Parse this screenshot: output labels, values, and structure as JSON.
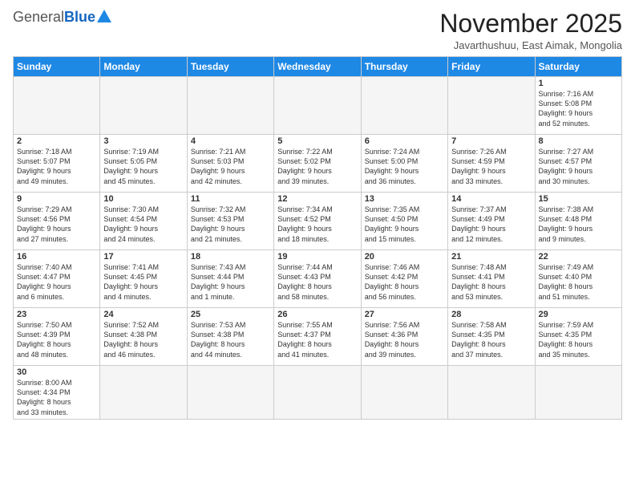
{
  "logo": {
    "general": "General",
    "blue": "Blue"
  },
  "header": {
    "month": "November 2025",
    "location": "Javarthushuu, East Aimak, Mongolia"
  },
  "weekdays": [
    "Sunday",
    "Monday",
    "Tuesday",
    "Wednesday",
    "Thursday",
    "Friday",
    "Saturday"
  ],
  "weeks": [
    [
      {
        "day": "",
        "info": ""
      },
      {
        "day": "",
        "info": ""
      },
      {
        "day": "",
        "info": ""
      },
      {
        "day": "",
        "info": ""
      },
      {
        "day": "",
        "info": ""
      },
      {
        "day": "",
        "info": ""
      },
      {
        "day": "1",
        "info": "Sunrise: 7:16 AM\nSunset: 5:08 PM\nDaylight: 9 hours\nand 52 minutes."
      }
    ],
    [
      {
        "day": "2",
        "info": "Sunrise: 7:18 AM\nSunset: 5:07 PM\nDaylight: 9 hours\nand 49 minutes."
      },
      {
        "day": "3",
        "info": "Sunrise: 7:19 AM\nSunset: 5:05 PM\nDaylight: 9 hours\nand 45 minutes."
      },
      {
        "day": "4",
        "info": "Sunrise: 7:21 AM\nSunset: 5:03 PM\nDaylight: 9 hours\nand 42 minutes."
      },
      {
        "day": "5",
        "info": "Sunrise: 7:22 AM\nSunset: 5:02 PM\nDaylight: 9 hours\nand 39 minutes."
      },
      {
        "day": "6",
        "info": "Sunrise: 7:24 AM\nSunset: 5:00 PM\nDaylight: 9 hours\nand 36 minutes."
      },
      {
        "day": "7",
        "info": "Sunrise: 7:26 AM\nSunset: 4:59 PM\nDaylight: 9 hours\nand 33 minutes."
      },
      {
        "day": "8",
        "info": "Sunrise: 7:27 AM\nSunset: 4:57 PM\nDaylight: 9 hours\nand 30 minutes."
      }
    ],
    [
      {
        "day": "9",
        "info": "Sunrise: 7:29 AM\nSunset: 4:56 PM\nDaylight: 9 hours\nand 27 minutes."
      },
      {
        "day": "10",
        "info": "Sunrise: 7:30 AM\nSunset: 4:54 PM\nDaylight: 9 hours\nand 24 minutes."
      },
      {
        "day": "11",
        "info": "Sunrise: 7:32 AM\nSunset: 4:53 PM\nDaylight: 9 hours\nand 21 minutes."
      },
      {
        "day": "12",
        "info": "Sunrise: 7:34 AM\nSunset: 4:52 PM\nDaylight: 9 hours\nand 18 minutes."
      },
      {
        "day": "13",
        "info": "Sunrise: 7:35 AM\nSunset: 4:50 PM\nDaylight: 9 hours\nand 15 minutes."
      },
      {
        "day": "14",
        "info": "Sunrise: 7:37 AM\nSunset: 4:49 PM\nDaylight: 9 hours\nand 12 minutes."
      },
      {
        "day": "15",
        "info": "Sunrise: 7:38 AM\nSunset: 4:48 PM\nDaylight: 9 hours\nand 9 minutes."
      }
    ],
    [
      {
        "day": "16",
        "info": "Sunrise: 7:40 AM\nSunset: 4:47 PM\nDaylight: 9 hours\nand 6 minutes."
      },
      {
        "day": "17",
        "info": "Sunrise: 7:41 AM\nSunset: 4:45 PM\nDaylight: 9 hours\nand 4 minutes."
      },
      {
        "day": "18",
        "info": "Sunrise: 7:43 AM\nSunset: 4:44 PM\nDaylight: 9 hours\nand 1 minute."
      },
      {
        "day": "19",
        "info": "Sunrise: 7:44 AM\nSunset: 4:43 PM\nDaylight: 8 hours\nand 58 minutes."
      },
      {
        "day": "20",
        "info": "Sunrise: 7:46 AM\nSunset: 4:42 PM\nDaylight: 8 hours\nand 56 minutes."
      },
      {
        "day": "21",
        "info": "Sunrise: 7:48 AM\nSunset: 4:41 PM\nDaylight: 8 hours\nand 53 minutes."
      },
      {
        "day": "22",
        "info": "Sunrise: 7:49 AM\nSunset: 4:40 PM\nDaylight: 8 hours\nand 51 minutes."
      }
    ],
    [
      {
        "day": "23",
        "info": "Sunrise: 7:50 AM\nSunset: 4:39 PM\nDaylight: 8 hours\nand 48 minutes."
      },
      {
        "day": "24",
        "info": "Sunrise: 7:52 AM\nSunset: 4:38 PM\nDaylight: 8 hours\nand 46 minutes."
      },
      {
        "day": "25",
        "info": "Sunrise: 7:53 AM\nSunset: 4:38 PM\nDaylight: 8 hours\nand 44 minutes."
      },
      {
        "day": "26",
        "info": "Sunrise: 7:55 AM\nSunset: 4:37 PM\nDaylight: 8 hours\nand 41 minutes."
      },
      {
        "day": "27",
        "info": "Sunrise: 7:56 AM\nSunset: 4:36 PM\nDaylight: 8 hours\nand 39 minutes."
      },
      {
        "day": "28",
        "info": "Sunrise: 7:58 AM\nSunset: 4:35 PM\nDaylight: 8 hours\nand 37 minutes."
      },
      {
        "day": "29",
        "info": "Sunrise: 7:59 AM\nSunset: 4:35 PM\nDaylight: 8 hours\nand 35 minutes."
      }
    ],
    [
      {
        "day": "30",
        "info": "Sunrise: 8:00 AM\nSunset: 4:34 PM\nDaylight: 8 hours\nand 33 minutes."
      },
      {
        "day": "",
        "info": ""
      },
      {
        "day": "",
        "info": ""
      },
      {
        "day": "",
        "info": ""
      },
      {
        "day": "",
        "info": ""
      },
      {
        "day": "",
        "info": ""
      },
      {
        "day": "",
        "info": ""
      }
    ]
  ]
}
